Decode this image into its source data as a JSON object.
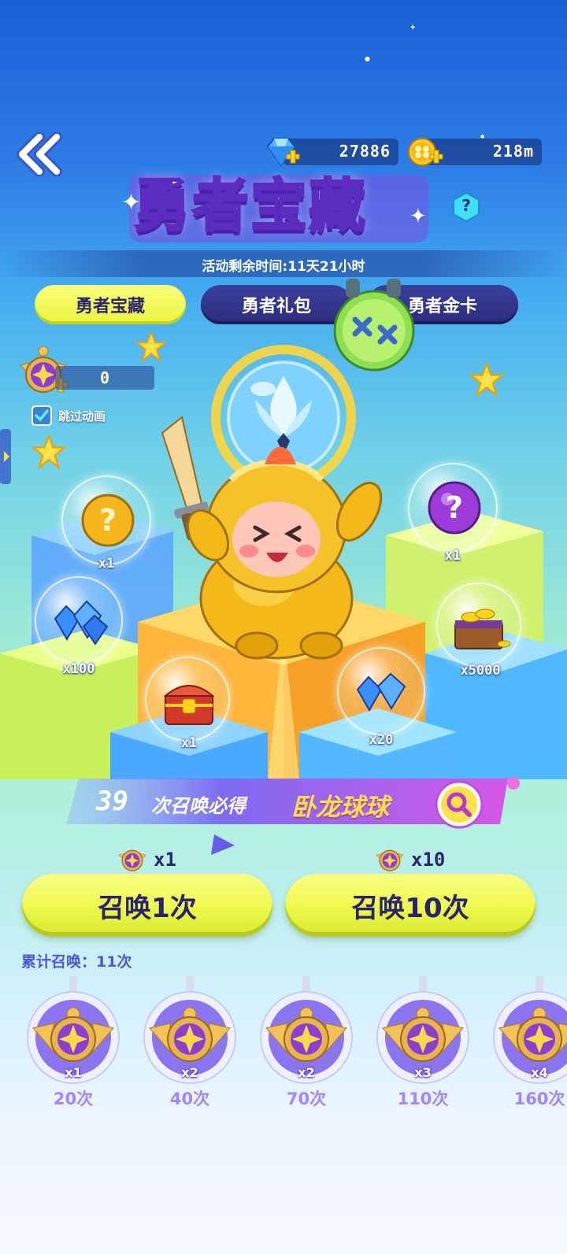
{
  "currency": {
    "gems": "27886",
    "coins": "218m"
  },
  "title": "勇者宝藏",
  "help_glyph": "?",
  "timer": "活动剩余时间:11天21小时",
  "tabs": [
    {
      "label": "勇者宝藏",
      "active": true
    },
    {
      "label": "勇者礼包",
      "active": false
    },
    {
      "label": "勇者金卡",
      "active": false
    }
  ],
  "ticket_count": "0",
  "skip_animation": {
    "label": "跳过动画",
    "checked": true
  },
  "rewards": [
    {
      "icon": "gold-mystery-ball-icon",
      "qty": "x1"
    },
    {
      "icon": "purple-mystery-ball-icon",
      "qty": "x1"
    },
    {
      "icon": "blue-gems-pile-icon",
      "qty": "x100"
    },
    {
      "icon": "treasure-chest-coins-icon",
      "qty": "x5000"
    },
    {
      "icon": "red-treasure-chest-icon",
      "qty": "x1"
    },
    {
      "icon": "blue-gems-pile-icon",
      "qty": "x20"
    }
  ],
  "guarantee": {
    "count": "39",
    "text": "次召唤必得",
    "item": "卧龙球球"
  },
  "summon": {
    "single": {
      "cost": "x1",
      "label": "召唤1次"
    },
    "ten": {
      "cost": "x10",
      "label": "召唤10次"
    }
  },
  "total_summons": "累计召唤：11次",
  "milestones": [
    {
      "qty": "x1",
      "count": "20次"
    },
    {
      "qty": "x2",
      "count": "40次"
    },
    {
      "qty": "x2",
      "count": "70次"
    },
    {
      "qty": "x3",
      "count": "110次"
    },
    {
      "qty": "x4",
      "count": "160次"
    }
  ],
  "colors": {
    "accent_yellow": "#eef84a",
    "tab_dark": "#2b2d7a",
    "milestone_text": "#a584ff",
    "title_purple": "#5a2cbf"
  }
}
